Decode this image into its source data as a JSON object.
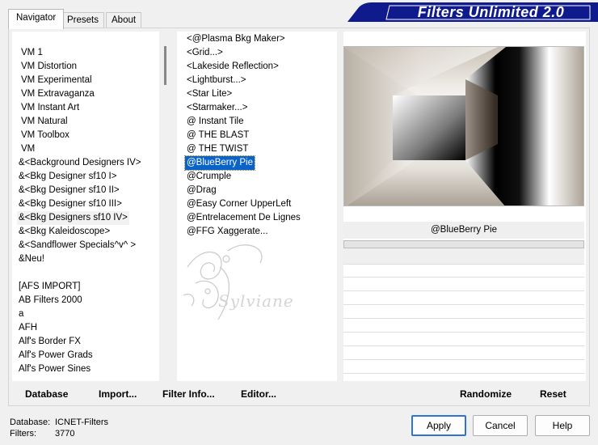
{
  "tabs": [
    {
      "label": "Navigator",
      "active": true
    },
    {
      "label": "Presets",
      "active": false
    },
    {
      "label": "About",
      "active": false
    }
  ],
  "banner": {
    "title": "Filters Unlimited 2.0",
    "color": "#0f1a8c"
  },
  "categories": {
    "items": [
      "VM 1",
      "VM Distortion",
      "VM Experimental",
      "VM Extravaganza",
      "VM Instant Art",
      "VM Natural",
      "VM Toolbox",
      "VM",
      "&<Background Designers IV>",
      "&<Bkg Designer sf10 I>",
      "&<Bkg Designer sf10 II>",
      "&<Bkg Designer sf10 III>",
      "&<Bkg Designers sf10 IV>",
      "&<Bkg Kaleidoscope>",
      "&<Sandflower Specials^v^ >",
      "&Neu!",
      "",
      "[AFS IMPORT]",
      "AB Filters 2000",
      "a",
      "AFH",
      "Alf's Border FX",
      "Alf's Power Grads",
      "Alf's Power Sines"
    ],
    "highlighted_index": 12
  },
  "filters": {
    "items": [
      "<@Plasma Bkg Maker>",
      "<Grid...>",
      "<Lakeside Reflection>",
      "<Lightburst...>",
      "<Star Lite>",
      "<Starmaker...>",
      "@ Instant Tile",
      "@ THE BLAST",
      "@ THE TWIST",
      "@BlueBerry Pie",
      "@Crumple",
      "@Drag",
      "@Easy Corner UpperLeft",
      "@Entrelacement De Lignes",
      "@FFG Xaggerate..."
    ],
    "selected_index": 9
  },
  "preview": {
    "selected_filter": "@BlueBerry Pie"
  },
  "watermark": {
    "text": "Sylviane"
  },
  "toolbar": {
    "database_label": "Database",
    "import_label": "Import...",
    "filter_info_label": "Filter Info...",
    "editor_label": "Editor...",
    "randomize_label": "Randomize",
    "reset_label": "Reset"
  },
  "status": {
    "database_label": "Database:",
    "database_value": "ICNET-Filters",
    "filters_label": "Filters:",
    "filters_value": "3770"
  },
  "buttons": {
    "apply": "Apply",
    "cancel": "Cancel",
    "help": "Help"
  },
  "colors": {
    "selection": "#0a64c8",
    "banner": "#0f1a8c",
    "default_button_border": "#2f74d0"
  }
}
